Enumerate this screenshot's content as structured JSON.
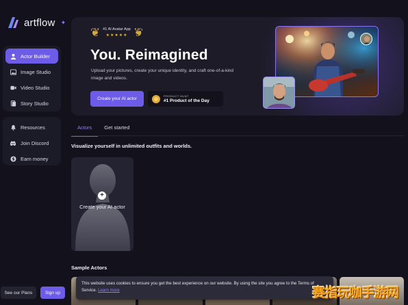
{
  "app": {
    "name": "artflow",
    "accent": "#6c5ce7"
  },
  "sidebar": {
    "primary": [
      {
        "label": "Actor Builder",
        "icon": "user-icon",
        "active": true
      },
      {
        "label": "Image Studio",
        "icon": "image-icon",
        "active": false
      },
      {
        "label": "Video Studio",
        "icon": "video-icon",
        "active": false
      },
      {
        "label": "Story Studio",
        "icon": "book-icon",
        "active": false
      }
    ],
    "secondary": [
      {
        "label": "Resources",
        "icon": "bell-icon"
      },
      {
        "label": "Join Discord",
        "icon": "discord-icon"
      },
      {
        "label": "Earn money",
        "icon": "dollar-icon"
      }
    ],
    "see_plans": "See our Plans",
    "sign_up": "Sign up"
  },
  "hero": {
    "award_title": "#1 AI Avatar App",
    "stars": "★★★★★",
    "title": "You. Reimagined",
    "subtitle": "Upload your pictures, create your unique identity, and craft one-of-a-kind image and videos.",
    "cta": "Create your AI actor",
    "product_hunt_small": "PRODUCT HUNT",
    "product_hunt_big": "#1 Product of the Day"
  },
  "tabs": [
    {
      "label": "Actors",
      "active": true
    },
    {
      "label": "Get started",
      "active": false
    }
  ],
  "section_title": "Visualize yourself in unlimited outfits and worlds.",
  "create_card": {
    "label": "Create your AI actor"
  },
  "sample_title": "Sample Actors",
  "cookie": {
    "text": "This website uses cookies to ensure you get the best experience on our website. By using the site you agree to the Terms of Service.",
    "link": "Learn more"
  },
  "watermark": "赛指玩咖手游网"
}
